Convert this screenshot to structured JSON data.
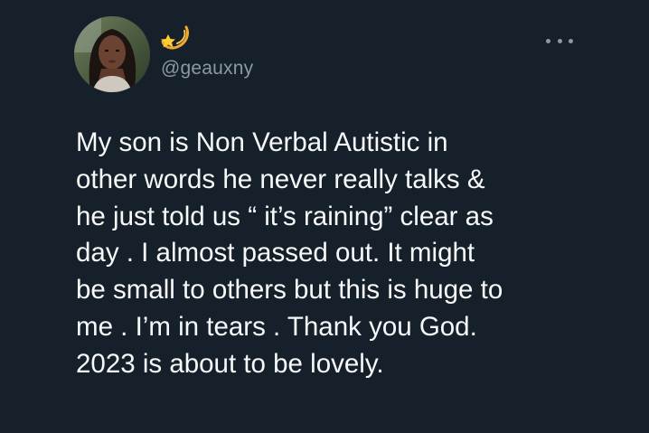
{
  "user": {
    "display_name_icon": "dizzy-star-emoji",
    "handle": "@geauxny"
  },
  "more_button": {
    "icon": "more-horizontal-icon"
  },
  "tweet": {
    "lines": [
      "My son is Non Verbal Autistic in",
      "other words he never really talks &",
      "he just told us “ it’s raining” clear as",
      "day . I almost passed out. It might",
      "be small to others but this is huge to",
      "me . I’m in tears . Thank you God.",
      "2023 is about to be lovely."
    ]
  },
  "colors": {
    "background": "#15202b",
    "text": "#f7f9f9",
    "secondary": "#8b98a5"
  }
}
